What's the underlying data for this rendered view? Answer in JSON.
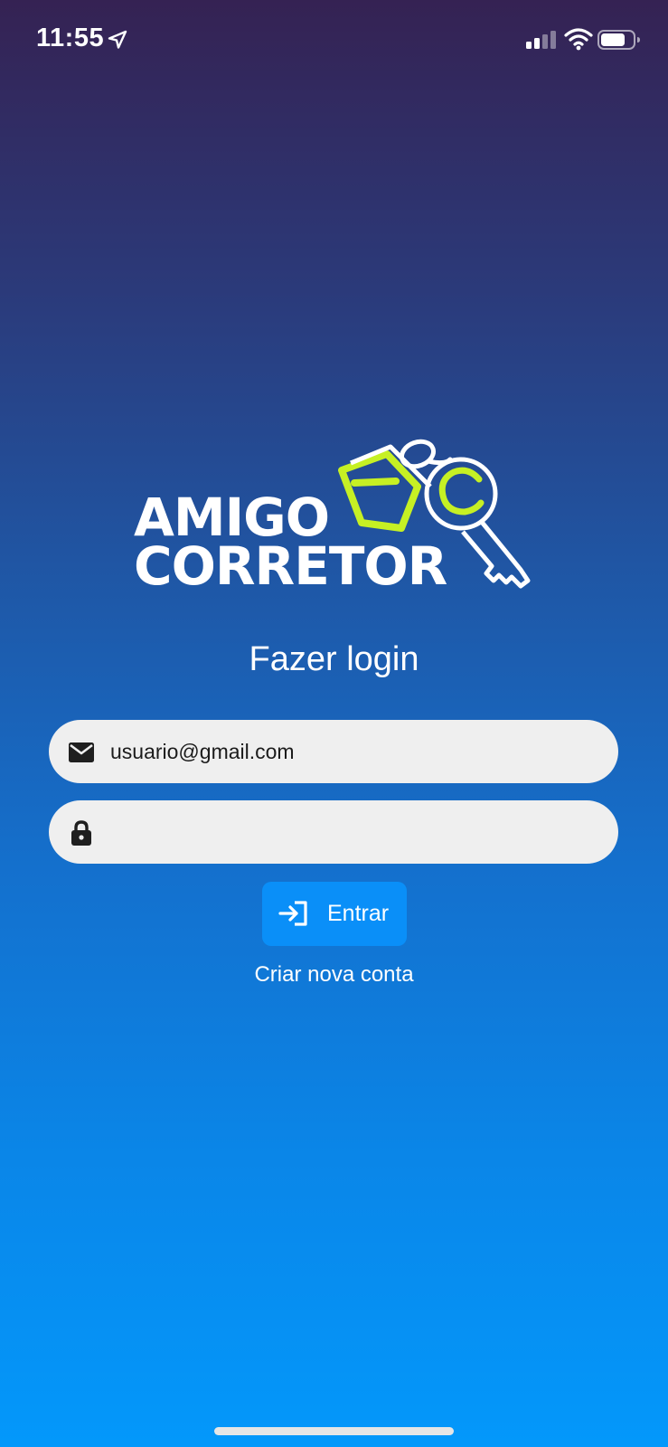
{
  "status_bar": {
    "time": "11:55",
    "icons": [
      "location-arrow-icon",
      "cellular-signal-icon",
      "wifi-icon",
      "battery-icon"
    ]
  },
  "logo": {
    "line1": "AMIGO",
    "line2": "CORRETOR",
    "brand_colors": {
      "white": "#ffffff",
      "accent_green": "#c6f024"
    }
  },
  "login": {
    "title": "Fazer login",
    "email": {
      "icon": "mail-icon",
      "value": "usuario@gmail.com"
    },
    "password": {
      "icon": "lock-icon",
      "value": ""
    },
    "submit": {
      "icon": "login-arrow-icon",
      "label": "Entrar"
    },
    "create_account_label": "Criar nova conta"
  },
  "colors": {
    "gradient_top": "#352253",
    "gradient_bottom": "#0398fb",
    "button": "#0a8ff8",
    "field_background": "#efefef"
  }
}
